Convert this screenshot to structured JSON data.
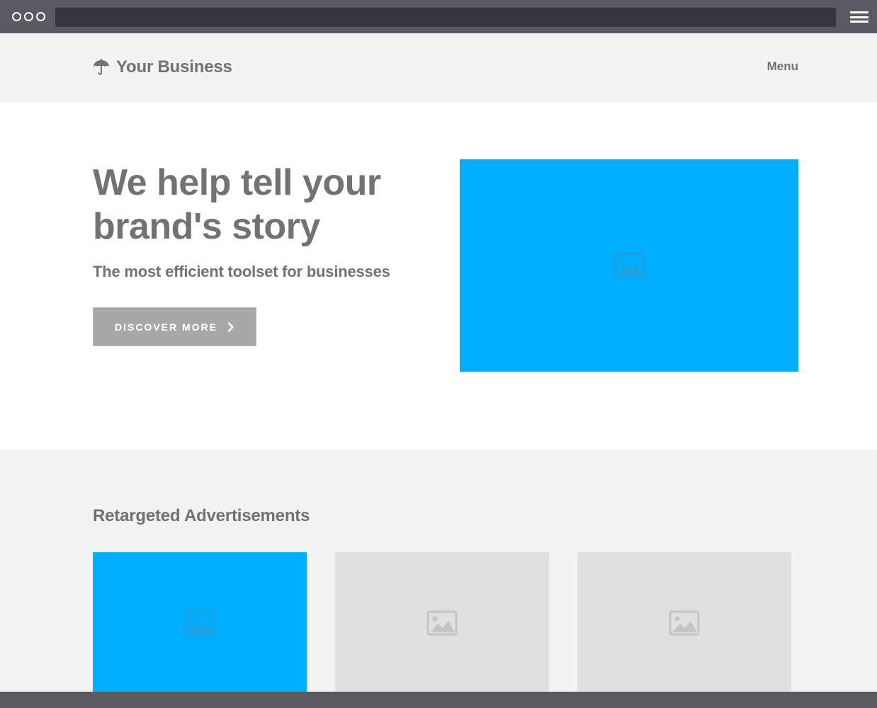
{
  "header": {
    "brand_name": "Your Business",
    "menu_label": "Menu"
  },
  "hero": {
    "title_line1": "We help tell your",
    "title_line2": "brand's story",
    "subtitle": "The most efficient toolset for businesses",
    "cta_label": "DISCOVER MORE"
  },
  "section": {
    "title": "Retargeted Advertisements"
  },
  "colors": {
    "accent": "#00aeff",
    "placeholder_gray": "#e0e0e0",
    "text": "#727272",
    "chrome": "#5b5a63"
  },
  "icons": {
    "logo": "umbrella-icon",
    "cta": "chevron-right-icon",
    "image_placeholder": "image-icon"
  }
}
